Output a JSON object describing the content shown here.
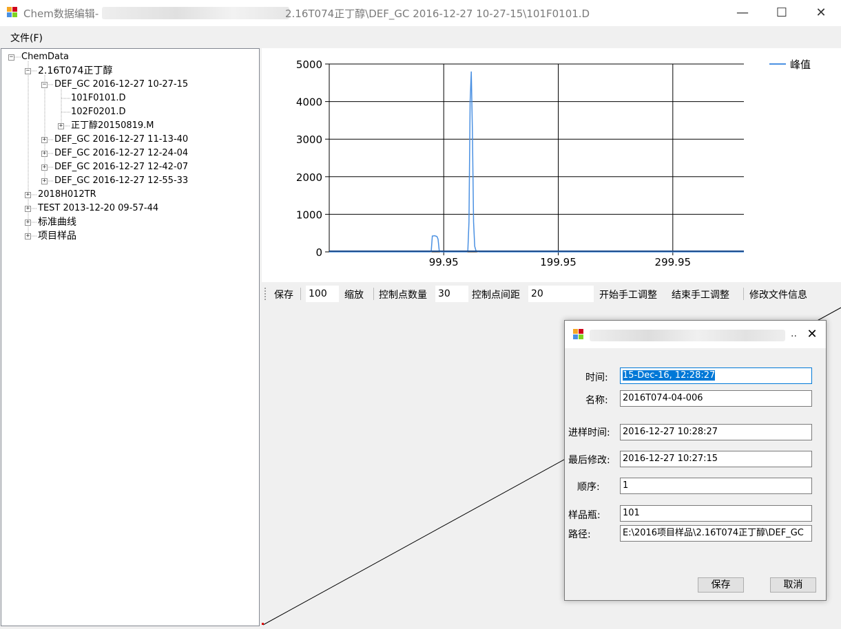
{
  "window": {
    "title_prefix": "Chem数据编辑-",
    "title_suffix": "2.16T074正丁醇\\DEF_GC 2016-12-27 10-27-15\\101F0101.D",
    "minimize": "—",
    "maximize": "☐",
    "close": "✕"
  },
  "menu": {
    "file": "文件(F)"
  },
  "tree": [
    {
      "label": "ChemData",
      "expander": "−"
    },
    {
      "label": "2.16T074正丁醇",
      "expander": "−"
    },
    {
      "label": "DEF_GC 2016-12-27 10-27-15",
      "expander": "−"
    },
    {
      "label": "101F0101.D",
      "expander": ""
    },
    {
      "label": "102F0201.D",
      "expander": ""
    },
    {
      "label": "正丁醇20150819.M",
      "expander": "+"
    },
    {
      "label": "DEF_GC 2016-12-27 11-13-40",
      "expander": "+"
    },
    {
      "label": "DEF_GC 2016-12-27 12-24-04",
      "expander": "+"
    },
    {
      "label": "DEF_GC 2016-12-27 12-42-07",
      "expander": "+"
    },
    {
      "label": "DEF_GC 2016-12-27 12-55-33",
      "expander": "+"
    },
    {
      "label": "2018H012TR",
      "expander": "+"
    },
    {
      "label": "TEST 2013-12-20 09-57-44",
      "expander": "+"
    },
    {
      "label": "标准曲线",
      "expander": "+"
    },
    {
      "label": "项目样品",
      "expander": "+"
    }
  ],
  "chart_data": {
    "type": "line",
    "legend": "峰值",
    "legend_position": "top-right",
    "grid": true,
    "ylim": [
      0,
      5000
    ],
    "xlim": [
      0,
      362
    ],
    "yticks": [
      "5000",
      "4000",
      "3000",
      "2000",
      "1000",
      "0"
    ],
    "xticks": [
      "99.95",
      "199.95",
      "299.95"
    ],
    "series_color": "#4a90e2",
    "series": [
      {
        "x": [
          0,
          88,
          89,
          90,
          92,
          94,
          95,
          96,
          97,
          98,
          100,
          110,
          120,
          121,
          122,
          123,
          124,
          125,
          126,
          127,
          128,
          129,
          131,
          140,
          200,
          300,
          362
        ],
        "y": [
          0,
          0,
          5,
          420,
          430,
          410,
          340,
          40,
          5,
          0,
          0,
          0,
          0,
          30,
          800,
          4000,
          4800,
          3200,
          800,
          150,
          40,
          10,
          0,
          0,
          0,
          0,
          0
        ]
      }
    ]
  },
  "toolbar": {
    "save": "保存",
    "zoom_value": "100",
    "zoom": "缩放",
    "ctrl_count_label": "控制点数量",
    "ctrl_count_value": "30",
    "ctrl_dist_label": "控制点间距",
    "ctrl_dist_value": "20",
    "start_manual": "开始手工调整",
    "end_manual": "结束手工调整",
    "edit_file_info": "修改文件信息"
  },
  "dialog": {
    "ellipsis": "..",
    "close": "✕",
    "fields": {
      "time_label": "时间:",
      "time_value": "15-Dec-16, 12:28:27",
      "name_label": "名称:",
      "name_value": "2016T074-04-006",
      "inject_label": "进样时间:",
      "inject_value": "2016-12-27 10:28:27",
      "modified_label": "最后修改:",
      "modified_value": "2016-12-27 10:27:15",
      "order_label": "顺序:",
      "order_value": "1",
      "vial_label": "样品瓶:",
      "vial_value": "101",
      "path_label": "路径:",
      "path_value": "E:\\2016项目样品\\2.16T074正丁醇\\DEF_GC"
    },
    "save": "保存",
    "cancel": "取消"
  }
}
